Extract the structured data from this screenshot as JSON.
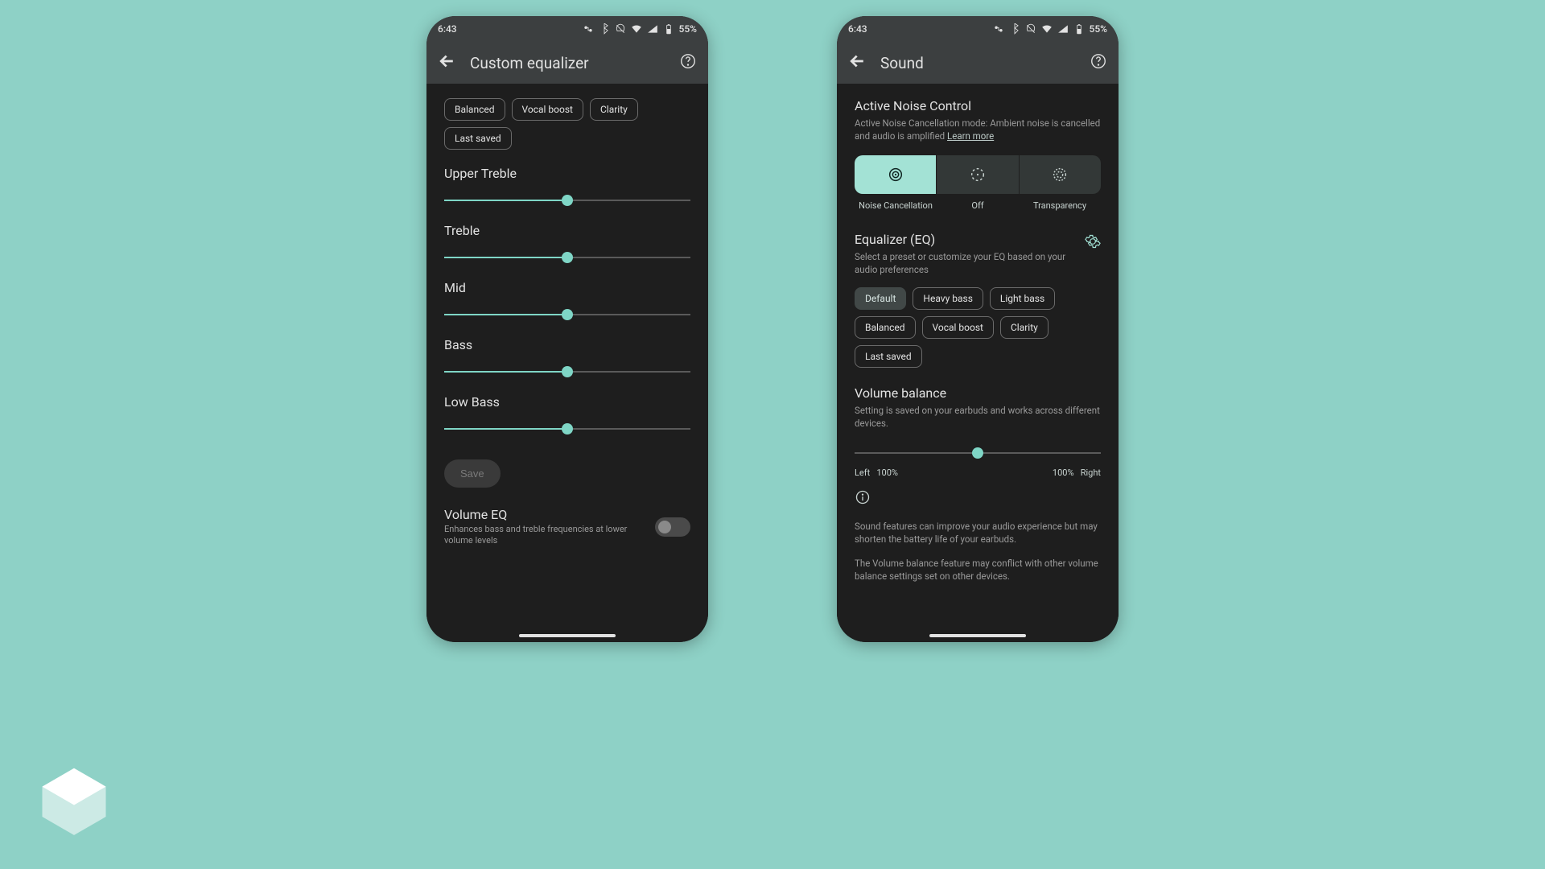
{
  "status": {
    "time": "6:43",
    "battery": "55%"
  },
  "left": {
    "title": "Custom equalizer",
    "chips": [
      "Balanced",
      "Vocal boost",
      "Clarity",
      "Last saved"
    ],
    "bands": [
      {
        "label": "Upper Treble",
        "value": 50
      },
      {
        "label": "Treble",
        "value": 50
      },
      {
        "label": "Mid",
        "value": 50
      },
      {
        "label": "Bass",
        "value": 50
      },
      {
        "label": "Low Bass",
        "value": 50
      }
    ],
    "save": "Save",
    "voleq": {
      "title": "Volume EQ",
      "sub": "Enhances bass and treble frequencies at lower volume levels"
    }
  },
  "right": {
    "title": "Sound",
    "anc": {
      "title": "Active Noise Control",
      "sub": "Active Noise Cancellation mode: Ambient noise is cancelled and audio is amplified ",
      "learn": "Learn more",
      "labels": [
        "Noise Cancellation",
        "Off",
        "Transparency"
      ],
      "active": 0
    },
    "eq": {
      "title": "Equalizer (EQ)",
      "sub": "Select a preset or customize your EQ based on your audio preferences",
      "chips": [
        "Default",
        "Heavy bass",
        "Light bass",
        "Balanced",
        "Vocal boost",
        "Clarity",
        "Last saved"
      ],
      "selected": "Default"
    },
    "vb": {
      "title": "Volume balance",
      "sub": "Setting is saved on your earbuds and works across different devices.",
      "left_label": "Left",
      "right_label": "Right",
      "left_pct": "100%",
      "right_pct": "100%",
      "value": 50
    },
    "notes": [
      "Sound features can improve your audio experience but may shorten the battery life of your earbuds.",
      "The Volume balance feature may conflict with other volume balance settings set on other devices."
    ]
  }
}
